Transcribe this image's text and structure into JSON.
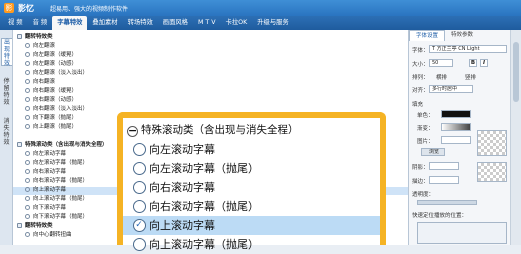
{
  "title_bar": {
    "logo_text": "影",
    "app_name": "影忆",
    "slogan": "超易用、强大的视频制作软件"
  },
  "menu": {
    "items": [
      "视 频",
      "音 频",
      "字幕特效",
      "叠加素材",
      "转场特效",
      "画面风格",
      "M T V",
      "卡拉OK",
      "升级与服务"
    ],
    "active": "字幕特效"
  },
  "side_tabs": [
    "出现特效",
    "停留特效",
    "消失特效"
  ],
  "tree": {
    "rows": [
      {
        "text": "翻转特效类",
        "type": "group"
      },
      {
        "text": "向左翻滚",
        "type": "item"
      },
      {
        "text": "向左翻滚（缓晃）",
        "type": "item"
      },
      {
        "text": "向左翻滚（动感）",
        "type": "item"
      },
      {
        "text": "向左翻滚（淡入淡出）",
        "type": "item"
      },
      {
        "text": "向右翻滚",
        "type": "item"
      },
      {
        "text": "向右翻滚（缓晃）",
        "type": "item"
      },
      {
        "text": "向右翻滚（动感）",
        "type": "item"
      },
      {
        "text": "向右翻滚（淡入淡出）",
        "type": "item"
      },
      {
        "text": "向下翻滚（抛尾）",
        "type": "item"
      },
      {
        "text": "向上翻滚（抛尾）",
        "type": "item"
      },
      {
        "text": "",
        "type": "blank"
      },
      {
        "text": "特殊滚动类（含出现与消失全程）",
        "type": "group"
      },
      {
        "text": "向左滚动字幕",
        "type": "item"
      },
      {
        "text": "向左滚动字幕（抛尾）",
        "type": "item"
      },
      {
        "text": "向右滚动字幕",
        "type": "item"
      },
      {
        "text": "向右滚动字幕（抛尾）",
        "type": "item"
      },
      {
        "text": "向上滚动字幕",
        "type": "selected"
      },
      {
        "text": "向上滚动字幕（抛尾）",
        "type": "item"
      },
      {
        "text": "向下滚动字幕",
        "type": "item"
      },
      {
        "text": "向下滚动字幕（抛尾）",
        "type": "item"
      },
      {
        "text": "翻转特效类",
        "type": "group"
      },
      {
        "text": "向中心翻转扭曲",
        "type": "item"
      }
    ]
  },
  "right_panel": {
    "tabs": [
      "字体设置",
      "特效参数"
    ],
    "font_label": "字体：",
    "font_value": "T 方正兰亭 CN Light",
    "size_label": "大小：",
    "size_value": "50",
    "bold": "B",
    "italic": "I",
    "layout_label": "排列：",
    "horizontal": "横排",
    "vertical": "竖排",
    "align_label": "对齐：",
    "align_value": "多行时居中",
    "fill_label": "填充",
    "color_label": "单色：",
    "gradient_label": "渐变：",
    "image_label": "图片：",
    "browse_label": "浏览",
    "shadow_label": "阴影：",
    "stroke_label": "描边：",
    "opacity_label": "透明度：",
    "quick_label": "快速定位播放的位置："
  },
  "overlay": {
    "header": "特殊滚动类（含出现与消失全程）",
    "items": [
      "向左滚动字幕",
      "向左滚动字幕（抛尾）",
      "向右滚动字幕",
      "向右滚动字幕（抛尾）",
      "向上滚动字幕",
      "向上滚动字幕（抛尾）"
    ],
    "selected": "向上滚动字幕",
    "accent": "#f5b324",
    "selected_bg": "#bcdbf5"
  }
}
